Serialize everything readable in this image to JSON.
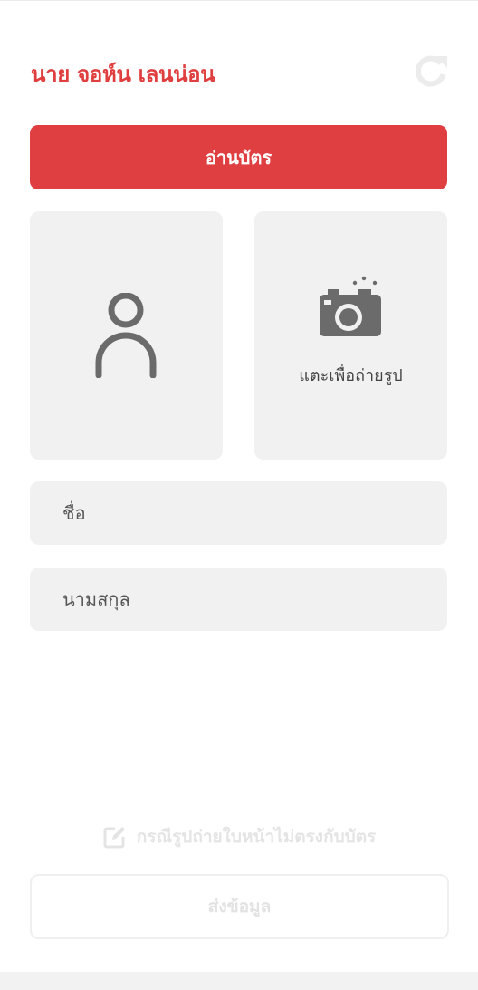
{
  "header": {
    "title": "นาย จอห์น เลนน่อน",
    "refresh_icon": "refresh-icon"
  },
  "read_card": {
    "label": "อ่านบัตร"
  },
  "card_photo": {
    "icon": "person-icon"
  },
  "take_photo": {
    "icon": "camera-icon",
    "label": "แตะเพื่อถ่ายรูป"
  },
  "form": {
    "first_name": {
      "placeholder": "ชื่อ"
    },
    "last_name": {
      "placeholder": "นามสกุล"
    }
  },
  "mismatch": {
    "icon": "edit-icon",
    "label": "กรณีรูปถ่ายใบหน้าไม่ตรงกับบัตร"
  },
  "submit": {
    "label": "ส่งข้อมูล"
  },
  "colors": {
    "accent": "#e03f41",
    "panel": "#f1f1f1",
    "icon": "#6b6b6b",
    "disabled_text": "#e2e2e2"
  }
}
